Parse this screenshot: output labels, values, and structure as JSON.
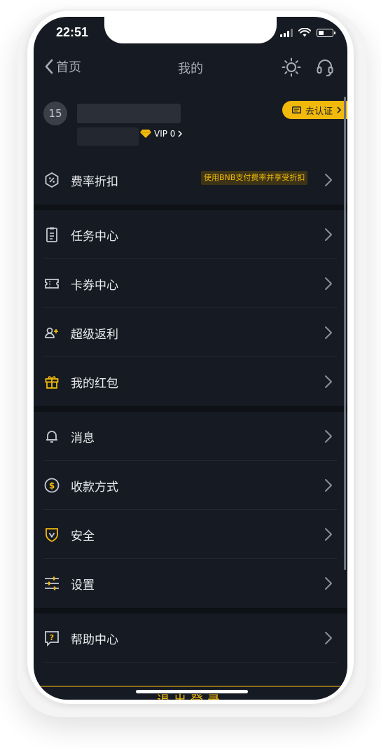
{
  "status_bar": {
    "time": "22:51"
  },
  "navbar": {
    "back_label": "首页",
    "title": "我的"
  },
  "profile": {
    "avatar_text": "15",
    "vip_label": "VIP 0",
    "verify_label": "去认证"
  },
  "fee": {
    "label": "费率折扣",
    "badge": "使用BNB支付费率并享受折扣"
  },
  "menu": [
    {
      "label": "任务中心",
      "icon": "clipboard-icon"
    },
    {
      "label": "卡券中心",
      "icon": "ticket-icon"
    },
    {
      "label": "超级返利",
      "icon": "user-add-icon"
    },
    {
      "label": "我的红包",
      "icon": "gift-icon"
    },
    {
      "label": "消息",
      "icon": "bell-icon"
    },
    {
      "label": "收款方式",
      "icon": "dollar-icon"
    },
    {
      "label": "安全",
      "icon": "shield-icon"
    },
    {
      "label": "设置",
      "icon": "sliders-icon"
    },
    {
      "label": "帮助中心",
      "icon": "help-icon"
    }
  ],
  "logout_label": "退出登录",
  "colors": {
    "accent": "#f0b90b",
    "background": "#161a22",
    "text": "#eaecef"
  }
}
